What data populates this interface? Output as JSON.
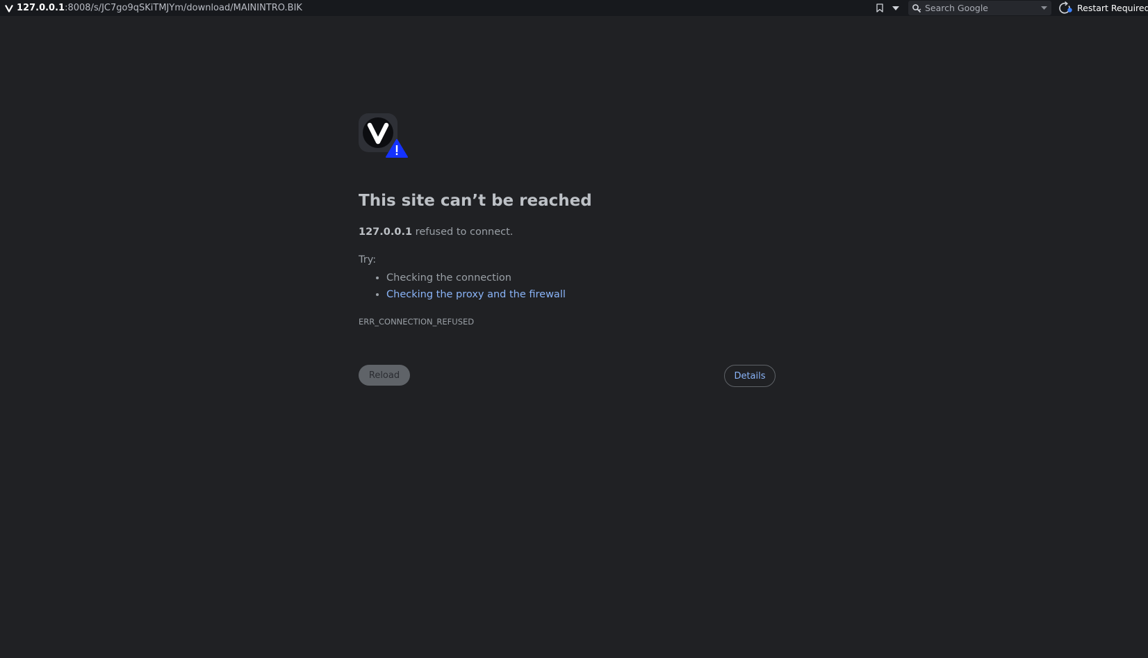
{
  "browser": {
    "address_bar": {
      "host": "127.0.0.1",
      "rest": ":8008/s/JC7go9qSKiTMJYm/download/MAININTRO.BIK"
    },
    "search": {
      "placeholder": "Search Google"
    },
    "restart_label": "Restart Required",
    "icons": [
      "vivaldi-logo-icon",
      "bookmark-icon",
      "chevron-down-icon",
      "search-icon",
      "chevron-down-icon",
      "restart-icon"
    ]
  },
  "error_page": {
    "title": "This site can’t be reached",
    "summary_host": "127.0.0.1",
    "summary_text": " refused to connect.",
    "try_label": "Try:",
    "suggestions": [
      {
        "text": "Checking the connection",
        "is_link": false
      },
      {
        "text": "Checking the proxy and the firewall",
        "is_link": true
      }
    ],
    "error_code": "ERR_CONNECTION_REFUSED",
    "reload_label": "Reload",
    "details_label": "Details"
  },
  "colors": {
    "background": "#202124",
    "topbar": "#17191d",
    "link": "#8ab4f8",
    "warning_blue": "#1432ff"
  }
}
